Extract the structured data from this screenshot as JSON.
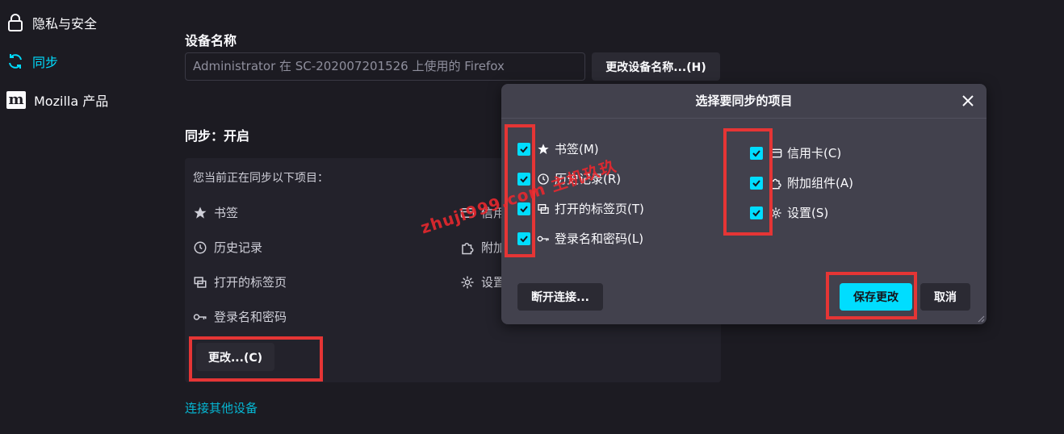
{
  "sidebar": {
    "items": [
      {
        "label": "隐私与安全",
        "icon": "lock-icon"
      },
      {
        "label": "同步",
        "icon": "sync-icon",
        "active": true
      },
      {
        "label": "Mozilla 产品",
        "icon": "mozilla-logo-icon"
      }
    ]
  },
  "device": {
    "title": "设备名称",
    "input_value": "Administrator 在 SC-202007201526 上使用的 Firefox",
    "rename_button": "更改设备名称...(H)"
  },
  "sync": {
    "title": "同步：开启",
    "intro": "您当前正在同步以下项目：",
    "items_left": [
      {
        "label": "书签",
        "icon": "star-icon"
      },
      {
        "label": "历史记录",
        "icon": "clock-icon"
      },
      {
        "label": "打开的标签页",
        "icon": "tabs-icon"
      },
      {
        "label": "登录名和密码",
        "icon": "key-icon"
      }
    ],
    "items_right": [
      {
        "label": "信用",
        "icon": "credit-card-icon"
      },
      {
        "label": "附加",
        "icon": "puzzle-icon"
      },
      {
        "label": "设置",
        "icon": "gear-icon"
      }
    ],
    "change_button": "更改...(C)",
    "connect_link": "连接其他设备"
  },
  "dialog": {
    "title": "选择要同步的项目",
    "left_options": [
      {
        "label": "书签(M)",
        "icon": "star-icon",
        "checked": true
      },
      {
        "label": "历史记录(R)",
        "icon": "clock-icon",
        "checked": true
      },
      {
        "label": "打开的标签页(T)",
        "icon": "tabs-icon",
        "checked": true
      },
      {
        "label": "登录名和密码(L)",
        "icon": "key-icon",
        "checked": true
      }
    ],
    "right_options": [
      {
        "label": "信用卡(C)",
        "icon": "credit-card-icon",
        "checked": true
      },
      {
        "label": "附加组件(A)",
        "icon": "puzzle-icon",
        "checked": true
      },
      {
        "label": "设置(S)",
        "icon": "gear-icon",
        "checked": true
      }
    ],
    "disconnect_button": "断开连接...",
    "save_button": "保存更改",
    "cancel_button": "取消"
  },
  "watermark": "zhuji999.com 主机玖玖",
  "colors": {
    "accent": "#00ddff",
    "highlight": "#e53535",
    "background": "#1c1b22",
    "dialog": "#42414d"
  }
}
